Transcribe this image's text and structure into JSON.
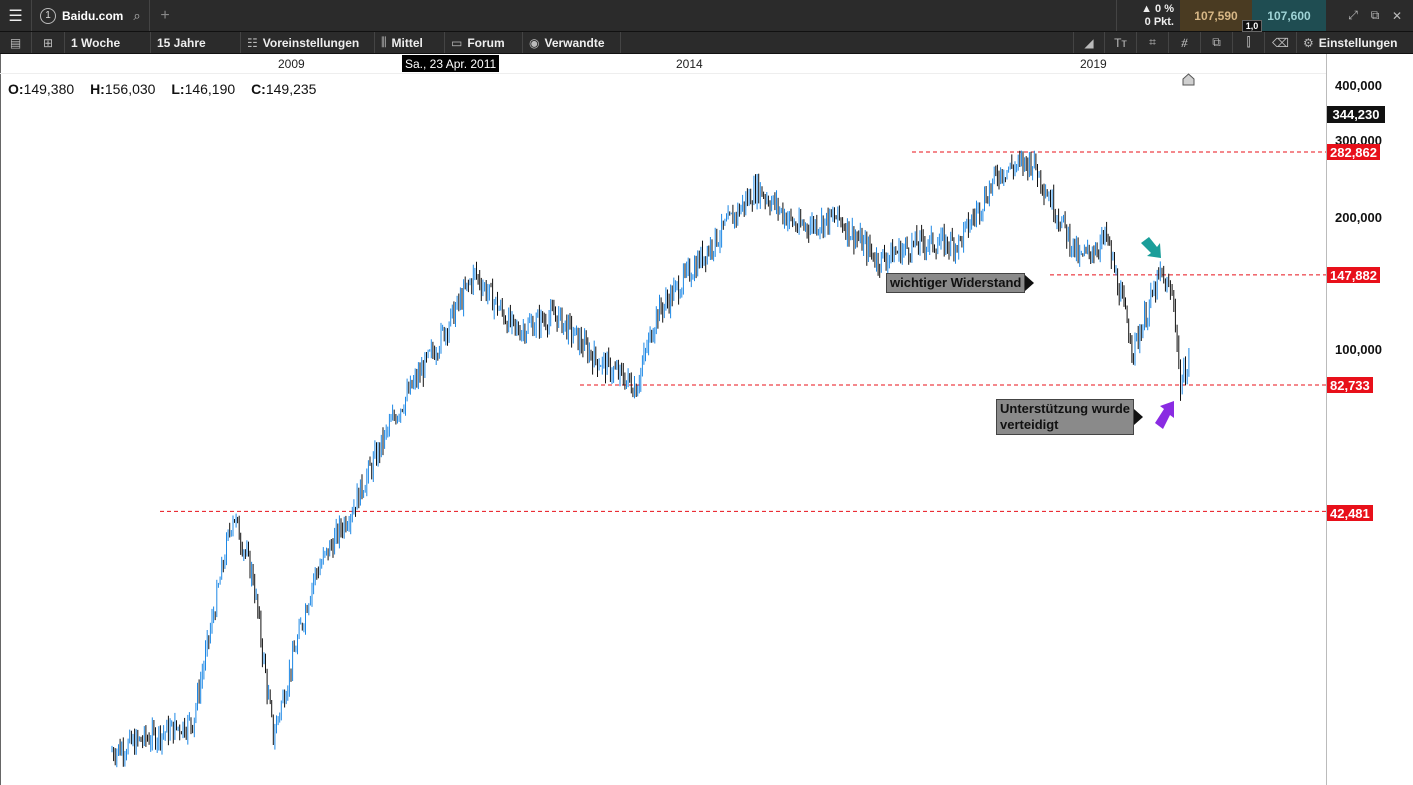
{
  "topbar": {
    "tab_number": "1",
    "symbol": "Baidu.com",
    "change_pct": "▲ 0 %",
    "change_pts": "0 Pkt.",
    "bid": "107,590",
    "ask": "107,600",
    "spread": "1,0"
  },
  "toolbar": {
    "interval": "1 Woche",
    "range": "15 Jahre",
    "presets": "Voreinstellungen",
    "indicator": "Mittel",
    "forum": "Forum",
    "related": "Verwandte",
    "settings": "Einstellungen"
  },
  "chart": {
    "years": [
      "2009",
      "2014",
      "2019"
    ],
    "crosshair_date": "Sa., 23 Apr. 2011",
    "ohlc": {
      "o_label": "O:",
      "o": "149,380",
      "h_label": "H:",
      "h": "156,030",
      "l_label": "L:",
      "l": "146,190",
      "c_label": "C:",
      "c": "149,235"
    },
    "price_labels": [
      "400,000",
      "300,000",
      "200,000",
      "100,000"
    ],
    "current_price": "344,230",
    "levels": [
      "282,862",
      "147,882",
      "82,733",
      "42,481"
    ],
    "annotations": {
      "resistance": "wichtiger Widerstand",
      "support_line1": "Unterstützung wurde",
      "support_line2": "verteidigt"
    },
    "colors": {
      "up": "#1e88e5",
      "down": "#111111",
      "level": "#e8101a",
      "teal_arrow": "#1a9e9a",
      "purple_arrow": "#8a2be2"
    }
  },
  "chart_data": {
    "type": "line",
    "title": "",
    "xlabel": "",
    "ylabel": "",
    "y_scale": "log",
    "ylim": [
      11,
      410
    ],
    "x": [
      "2006-12",
      "2007-12",
      "2008-06",
      "2008-09",
      "2008-12",
      "2009-06",
      "2009-12",
      "2010-06",
      "2010-12",
      "2011-06",
      "2011-12",
      "2012-06",
      "2012-12",
      "2013-06",
      "2013-09",
      "2014-06",
      "2014-12",
      "2015-06",
      "2015-12",
      "2016-06",
      "2016-12",
      "2017-06",
      "2017-12",
      "2018-05",
      "2018-12",
      "2019-04",
      "2019-08",
      "2019-12",
      "2020-02",
      "2020-03",
      "2020-05"
    ],
    "series": [
      {
        "values": [
          12,
          14,
          42,
          30,
          13,
          30,
          44,
          70,
          100,
          149,
          110,
          120,
          95,
          82,
          120,
          180,
          235,
          190,
          200,
          160,
          175,
          175,
          255,
          270,
          160,
          180,
          100,
          148,
          130,
          82,
          105
        ]
      }
    ],
    "levels": [
      282.862,
      147.882,
      82.733,
      42.481
    ],
    "current": 344.23
  }
}
